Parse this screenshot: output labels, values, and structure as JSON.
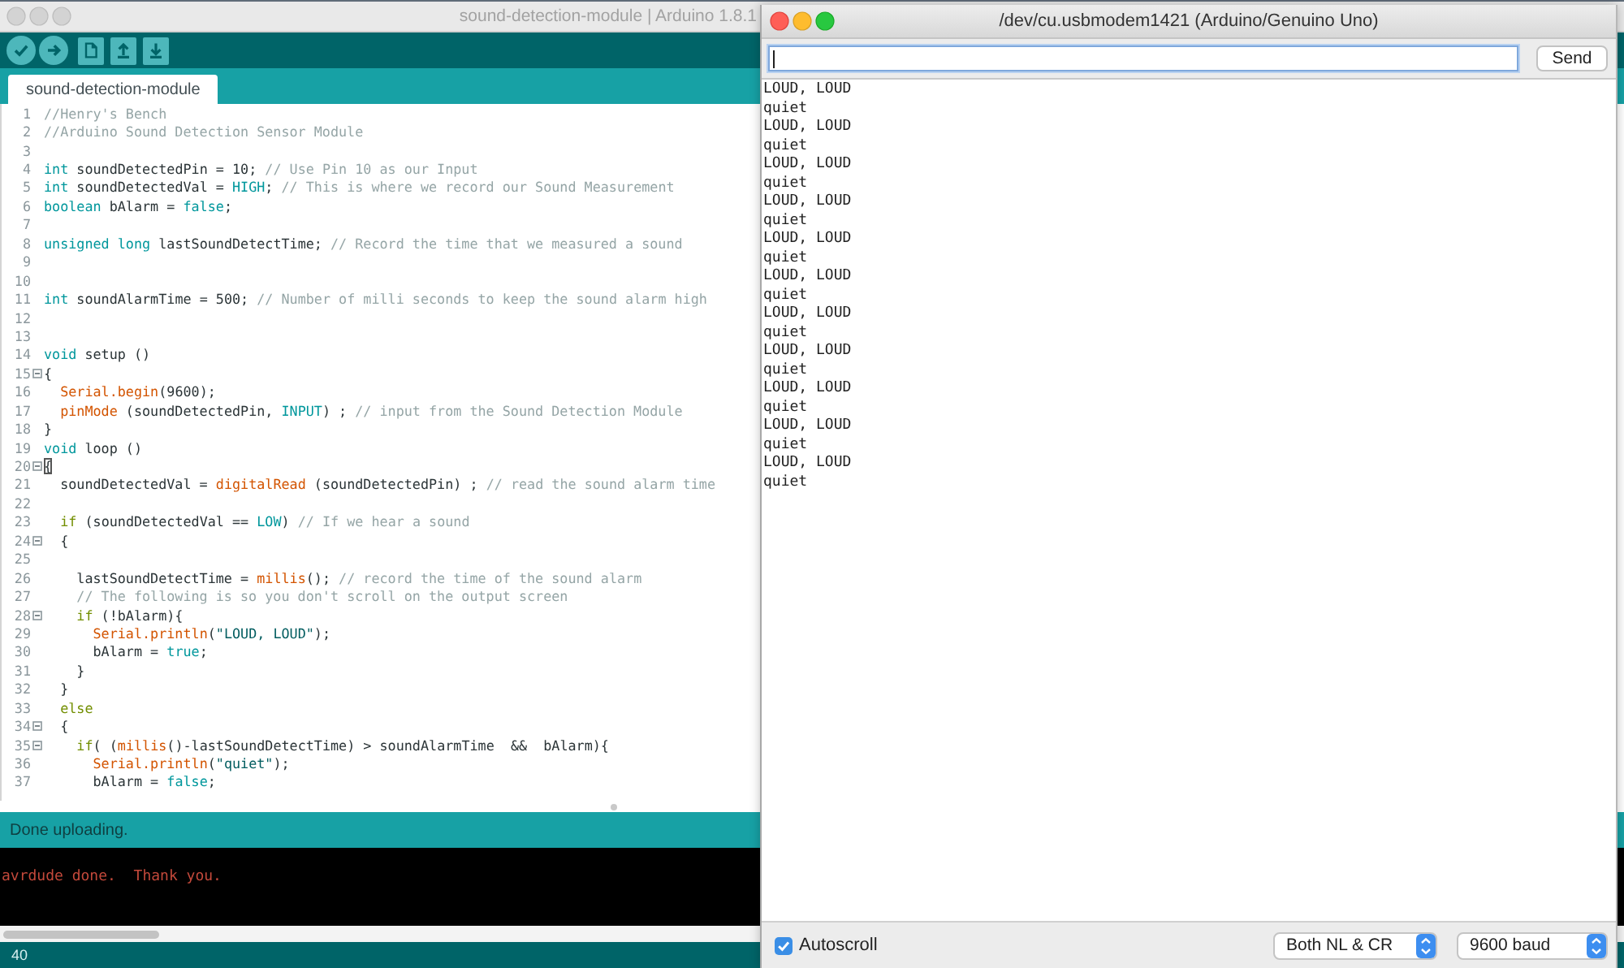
{
  "editor_window": {
    "title": "sound-detection-module | Arduino 1.8.1",
    "active": false,
    "tabs": [
      {
        "label": "sound-detection-module",
        "selected": true
      }
    ],
    "code_lines": [
      {
        "number": "1",
        "fold": false,
        "tokens": [
          {
            "kind": "comment",
            "text": "//Henry's Bench"
          }
        ]
      },
      {
        "number": "2",
        "fold": false,
        "tokens": [
          {
            "kind": "comment",
            "text": "//Arduino Sound Detection Sensor Module"
          }
        ]
      },
      {
        "number": "3",
        "fold": false
      },
      {
        "number": "4",
        "fold": false,
        "tokens": [
          {
            "kind": "keyword",
            "text": "int"
          },
          {
            "kind": "text",
            "text": " soundDetectedPin = 10; "
          },
          {
            "kind": "comment",
            "text": "// Use Pin 10 as our Input"
          }
        ]
      },
      {
        "number": "5",
        "fold": false,
        "tokens": [
          {
            "kind": "keyword",
            "text": "int"
          },
          {
            "kind": "text",
            "text": " soundDetectedVal = "
          },
          {
            "kind": "keyword",
            "text": "HIGH"
          },
          {
            "kind": "text",
            "text": "; "
          },
          {
            "kind": "comment",
            "text": "// This is where we record our Sound Measurement"
          }
        ]
      },
      {
        "number": "6",
        "fold": false,
        "tokens": [
          {
            "kind": "keyword",
            "text": "boolean"
          },
          {
            "kind": "text",
            "text": " bAlarm = "
          },
          {
            "kind": "keyword",
            "text": "false"
          },
          {
            "kind": "text",
            "text": ";"
          }
        ]
      },
      {
        "number": "7",
        "fold": false
      },
      {
        "number": "8",
        "fold": false,
        "tokens": [
          {
            "kind": "keyword",
            "text": "unsigned long"
          },
          {
            "kind": "text",
            "text": " lastSoundDetectTime; "
          },
          {
            "kind": "comment",
            "text": "// Record the time that we measured a sound"
          }
        ]
      },
      {
        "number": "9",
        "fold": false
      },
      {
        "number": "10",
        "fold": false
      },
      {
        "number": "11",
        "fold": false,
        "tokens": [
          {
            "kind": "keyword",
            "text": "int"
          },
          {
            "kind": "text",
            "text": " soundAlarmTime = 500; "
          },
          {
            "kind": "comment",
            "text": "// Number of milli seconds to keep the sound alarm high"
          }
        ]
      },
      {
        "number": "12",
        "fold": false
      },
      {
        "number": "13",
        "fold": false
      },
      {
        "number": "14",
        "fold": false,
        "tokens": [
          {
            "kind": "keyword",
            "text": "void"
          },
          {
            "kind": "text",
            "text": " setup ()"
          }
        ]
      },
      {
        "number": "15",
        "fold": true,
        "tokens": [
          {
            "kind": "text",
            "text": "{"
          }
        ]
      },
      {
        "number": "16",
        "fold": false,
        "tokens": [
          {
            "kind": "function",
            "text": "  Serial.begin"
          },
          {
            "kind": "text",
            "text": "(9600);"
          }
        ]
      },
      {
        "number": "17",
        "fold": false,
        "tokens": [
          {
            "kind": "function",
            "text": "  pinMode"
          },
          {
            "kind": "text",
            "text": " (soundDetectedPin, "
          },
          {
            "kind": "keyword",
            "text": "INPUT"
          },
          {
            "kind": "text",
            "text": ") ; "
          },
          {
            "kind": "comment",
            "text": "// input from the Sound Detection Module"
          }
        ]
      },
      {
        "number": "18",
        "fold": false,
        "tokens": [
          {
            "kind": "text",
            "text": "}"
          }
        ]
      },
      {
        "number": "19",
        "fold": false,
        "tokens": [
          {
            "kind": "keyword",
            "text": "void"
          },
          {
            "kind": "text",
            "text": " loop ()"
          }
        ]
      },
      {
        "number": "20",
        "fold": true,
        "tokens": [
          {
            "kind": "matched-bracket",
            "text": "{"
          }
        ]
      },
      {
        "number": "21",
        "fold": false,
        "tokens": [
          {
            "kind": "text",
            "text": "  soundDetectedVal = "
          },
          {
            "kind": "function",
            "text": "digitalRead"
          },
          {
            "kind": "text",
            "text": " (soundDetectedPin) ; "
          },
          {
            "kind": "comment",
            "text": "// read the sound alarm time"
          }
        ]
      },
      {
        "number": "22",
        "fold": false
      },
      {
        "number": "23",
        "fold": false,
        "tokens": [
          {
            "kind": "control",
            "text": "  if"
          },
          {
            "kind": "text",
            "text": " (soundDetectedVal == "
          },
          {
            "kind": "keyword",
            "text": "LOW"
          },
          {
            "kind": "text",
            "text": ") "
          },
          {
            "kind": "comment",
            "text": "// If we hear a sound"
          }
        ]
      },
      {
        "number": "24",
        "fold": true,
        "tokens": [
          {
            "kind": "text",
            "text": "  {"
          }
        ]
      },
      {
        "number": "25",
        "fold": false
      },
      {
        "number": "26",
        "fold": false,
        "tokens": [
          {
            "kind": "text",
            "text": "    lastSoundDetectTime = "
          },
          {
            "kind": "function",
            "text": "millis"
          },
          {
            "kind": "text",
            "text": "(); "
          },
          {
            "kind": "comment",
            "text": "// record the time of the sound alarm"
          }
        ]
      },
      {
        "number": "27",
        "fold": false,
        "tokens": [
          {
            "kind": "comment",
            "text": "    // The following is so you don't scroll on the output screen"
          }
        ]
      },
      {
        "number": "28",
        "fold": true,
        "tokens": [
          {
            "kind": "control",
            "text": "    if"
          },
          {
            "kind": "text",
            "text": " (!bAlarm){"
          }
        ]
      },
      {
        "number": "29",
        "fold": false,
        "tokens": [
          {
            "kind": "function",
            "text": "      Serial.println"
          },
          {
            "kind": "text",
            "text": "("
          },
          {
            "kind": "string",
            "text": "\"LOUD, LOUD\""
          },
          {
            "kind": "text",
            "text": ");"
          }
        ]
      },
      {
        "number": "30",
        "fold": false,
        "tokens": [
          {
            "kind": "text",
            "text": "      bAlarm = "
          },
          {
            "kind": "keyword",
            "text": "true"
          },
          {
            "kind": "text",
            "text": ";"
          }
        ]
      },
      {
        "number": "31",
        "fold": false,
        "tokens": [
          {
            "kind": "text",
            "text": "    }"
          }
        ]
      },
      {
        "number": "32",
        "fold": false,
        "tokens": [
          {
            "kind": "text",
            "text": "  }"
          }
        ]
      },
      {
        "number": "33",
        "fold": false,
        "tokens": [
          {
            "kind": "control",
            "text": "  else"
          }
        ]
      },
      {
        "number": "34",
        "fold": true,
        "tokens": [
          {
            "kind": "text",
            "text": "  {"
          }
        ]
      },
      {
        "number": "35",
        "fold": true,
        "tokens": [
          {
            "kind": "control",
            "text": "    if"
          },
          {
            "kind": "text",
            "text": "( ("
          },
          {
            "kind": "function",
            "text": "millis"
          },
          {
            "kind": "text",
            "text": "()-lastSoundDetectTime) > soundAlarmTime  &&  bAlarm){"
          }
        ]
      },
      {
        "number": "36",
        "fold": false,
        "tokens": [
          {
            "kind": "function",
            "text": "      Serial.println"
          },
          {
            "kind": "text",
            "text": "("
          },
          {
            "kind": "string",
            "text": "\"quiet\""
          },
          {
            "kind": "text",
            "text": ");"
          }
        ]
      },
      {
        "number": "37",
        "fold": false,
        "tokens": [
          {
            "kind": "text",
            "text": "      bAlarm = "
          },
          {
            "kind": "keyword",
            "text": "false"
          },
          {
            "kind": "text",
            "text": ";"
          }
        ]
      }
    ],
    "status_message": "Done uploading.",
    "console_lines": [
      "avrdude done.  Thank you."
    ],
    "line_indicator": "40"
  },
  "serial_monitor": {
    "title": "/dev/cu.usbmodem1421 (Arduino/Genuino Uno)",
    "active": true,
    "input": {
      "focused": true
    },
    "send_button": "Send",
    "output_lines": [
      "LOUD, LOUD",
      "quiet",
      "LOUD, LOUD",
      "quiet",
      "LOUD, LOUD",
      "quiet",
      "LOUD, LOUD",
      "quiet",
      "LOUD, LOUD",
      "quiet",
      "LOUD, LOUD",
      "quiet",
      "LOUD, LOUD",
      "quiet",
      "LOUD, LOUD",
      "quiet",
      "LOUD, LOUD",
      "quiet",
      "LOUD, LOUD",
      "quiet",
      "LOUD, LOUD",
      "quiet"
    ],
    "autoscroll": {
      "label": "Autoscroll",
      "checked": true
    },
    "line_ending": "Both NL & CR",
    "baud_rate": "9600 baud"
  }
}
